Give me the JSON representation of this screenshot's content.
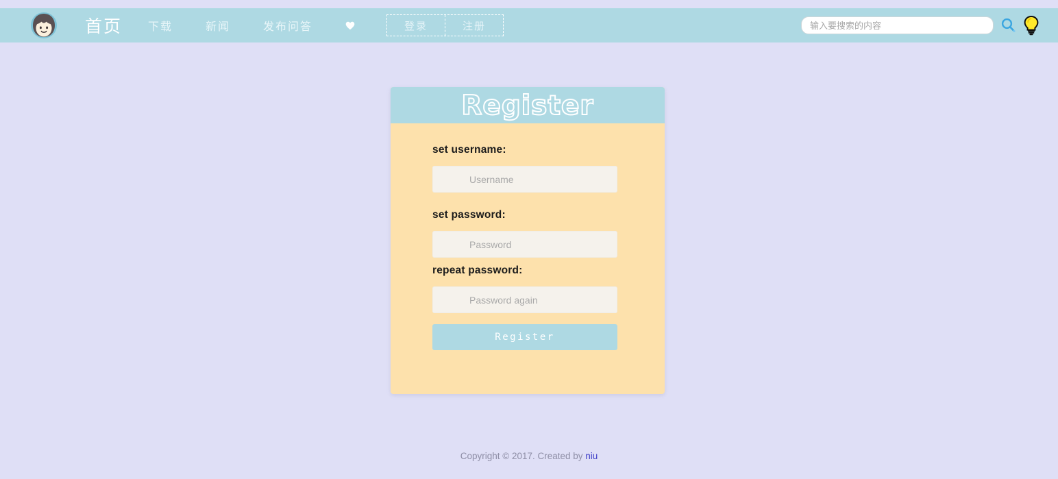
{
  "theme": {
    "page_bg": "#dfdff6",
    "navbar_bg": "#aed9e3",
    "card_body_bg": "#fde1ac",
    "card_header_bg": "#aed9e3",
    "input_bg": "#f5f2ec",
    "accent": "#aed9e3",
    "link": "#4040c8",
    "bulb_yellow": "#ffe92b"
  },
  "navbar": {
    "brand": {
      "icon": "avatar-face-icon",
      "label": ""
    },
    "links": [
      {
        "label": "首页",
        "name": "nav-item-home"
      },
      {
        "label": "下载",
        "name": "nav-item-download"
      },
      {
        "label": "新闻",
        "name": "nav-item-news"
      },
      {
        "label": "发布问答",
        "name": "nav-item-post-qa"
      }
    ],
    "heart_icon": "heart-icon",
    "auth": {
      "login_label": "登录",
      "register_label": "注册"
    },
    "search": {
      "placeholder": "输入要搜索的内容",
      "value": "",
      "search_icon": "search-icon",
      "bulb_icon": "lightbulb-icon"
    }
  },
  "card": {
    "title": "Register",
    "fields": [
      {
        "label": "set username:",
        "placeholder": "Username",
        "value": "",
        "type": "text",
        "name": "username"
      },
      {
        "label": "set password:",
        "placeholder": "Password",
        "value": "",
        "type": "password",
        "name": "password"
      },
      {
        "label": "repeat password:",
        "placeholder": "Password again",
        "value": "",
        "type": "password",
        "name": "password-repeat"
      }
    ],
    "submit_label": "Register"
  },
  "footer": {
    "text": "Copyright © 2017. Created by ",
    "author": "niu"
  }
}
